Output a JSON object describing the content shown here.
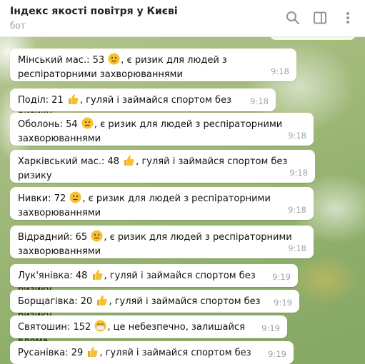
{
  "header": {
    "title": "Індекс якості повітря у Києві",
    "subtitle": "бот",
    "icons": [
      "search-icon",
      "sidebar-toggle-icon",
      "more-vertical-icon"
    ]
  },
  "colors": {
    "bubble": "#ffffff",
    "time": "#9aa5ae",
    "emoji_yellow": "#f5c033"
  },
  "messages": [
    {
      "before": "Мінський мас.: 53",
      "emoji": "neutral-face",
      "after": ", є ризик для людей з респіраторними захворюваннями",
      "time": "9:18"
    },
    {
      "before": "Поділ: 21",
      "emoji": "thumbs-up",
      "after": ", гуляй і займайся спортом без ризику",
      "time": "9:18"
    },
    {
      "before": "Оболонь: 54",
      "emoji": "neutral-face",
      "after": ", є ризик для людей з респіраторними захворюваннями",
      "time": "9:18"
    },
    {
      "before": "Харківський мас.: 48",
      "emoji": "thumbs-up",
      "after": ", гуляй і займайся спортом без ризику",
      "time": "9:18"
    },
    {
      "before": "Нивки: 72",
      "emoji": "neutral-face",
      "after": ", є ризик для людей з респіраторними захворюваннями",
      "time": "9:18"
    },
    {
      "before": "Відрадний: 65",
      "emoji": "neutral-face",
      "after": ", є ризик для людей з респіраторними захворюваннями",
      "time": "9:18"
    },
    {
      "before": "Лук'янівка: 48",
      "emoji": "thumbs-up",
      "after": ", гуляй і займайся спортом без ризику",
      "time": "9:19"
    },
    {
      "before": "Борщагівка: 20",
      "emoji": "thumbs-up",
      "after": ", гуляй і займайся спортом без ризику",
      "time": "9:19"
    },
    {
      "before": "Святошин: 152",
      "emoji": "mask-face",
      "after": ", це небезпечно, залишайся вдома",
      "time": "9:19"
    },
    {
      "before": "Русанівка: 29",
      "emoji": "thumbs-up",
      "after": ", гуляй і займайся спортом без ризику",
      "time": "9:19"
    }
  ]
}
